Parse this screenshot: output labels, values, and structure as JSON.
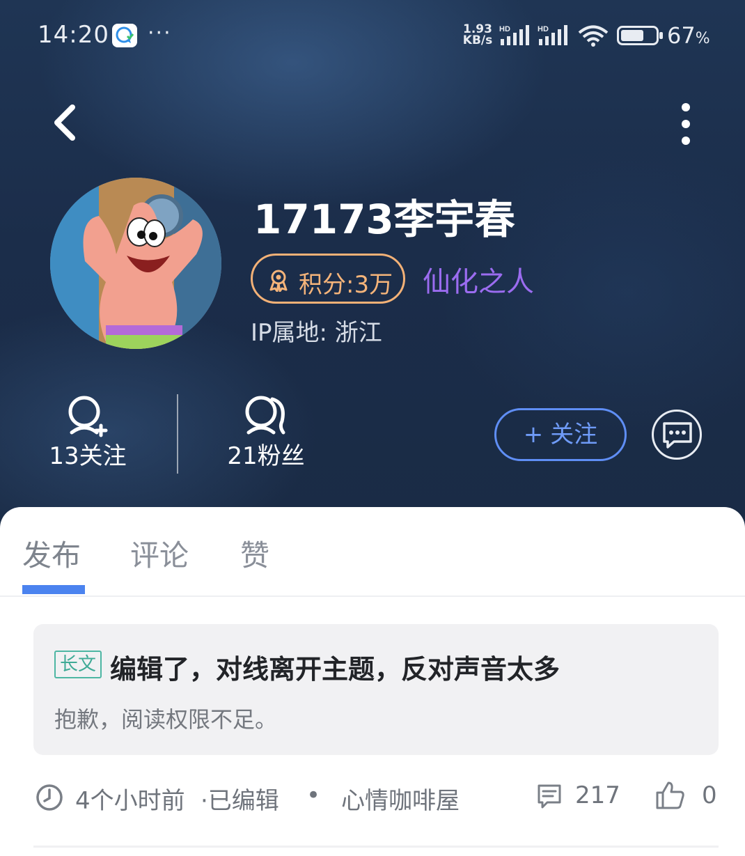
{
  "status_bar": {
    "time": "14:20",
    "more": "···",
    "speed_value": "1.93",
    "speed_unit": "KB/s",
    "signal_label": "HD",
    "battery_percent": "67",
    "battery_unit": "%",
    "battery_level": 0.67
  },
  "profile": {
    "username": "17173李宇春",
    "points_label": "积分:3万",
    "rank_title": "仙化之人",
    "ip_location": "IP属地: 浙江"
  },
  "stats": {
    "following": "13关注",
    "followers": "21粉丝"
  },
  "actions": {
    "follow_label": "关注",
    "follow_plus": "+"
  },
  "tabs": [
    {
      "label": "发布",
      "active": true
    },
    {
      "label": "评论",
      "active": false
    },
    {
      "label": "赞",
      "active": false
    }
  ],
  "post": {
    "tag": "长文",
    "title": "编辑了，对线离开主题，反对声音太多",
    "body": "抱歉，阅读权限不足。",
    "time": "4个小时前",
    "edited": "·已编辑",
    "separator": "•",
    "board": "心情咖啡屋",
    "comments": "217",
    "likes": "0"
  },
  "colors": {
    "accent_blue": "#4b83ef",
    "points_orange": "#f5b47a",
    "rank_purple": "#9b6cf0",
    "tag_teal": "#3faa96"
  }
}
